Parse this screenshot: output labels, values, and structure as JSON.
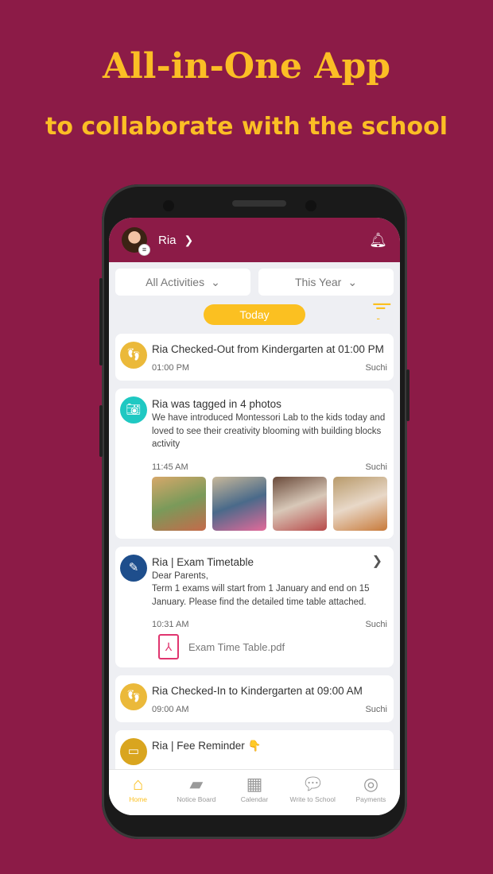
{
  "promo": {
    "title": "All-in-One App",
    "subtitle": "to collaborate with the school"
  },
  "header": {
    "child_name": "Ria"
  },
  "filters": {
    "activity": "All Activities",
    "period": "This Year"
  },
  "today_label": "Today",
  "colors": {
    "brand": "#8C1B47",
    "accent": "#FBC021"
  },
  "feed": [
    {
      "icon": "footprints-icon",
      "title": "Ria Checked-Out from Kindergarten at 01:00 PM",
      "time": "01:00 PM",
      "author": "Suchi"
    },
    {
      "icon": "camera-icon",
      "title": "Ria was tagged in 4 photos",
      "body": "We have introduced Montessori Lab to the kids today and loved to see their creativity blooming with building blocks activity",
      "time": "11:45 AM",
      "author": "Suchi"
    },
    {
      "icon": "pencil-icon",
      "title": "Ria | Exam Timetable",
      "body": "Dear Parents,\nTerm 1 exams will start from 1 January and end on 15 January. Please find the detailed time table attached.",
      "time": "10:31 AM",
      "author": "Suchi",
      "attachment": "Exam Time Table.pdf"
    },
    {
      "icon": "footprints-icon",
      "title": "Ria Checked-In to Kindergarten at 09:00 AM",
      "time": "09:00 AM",
      "author": "Suchi"
    },
    {
      "icon": "fee-icon",
      "title": "Ria | Fee Reminder 👇"
    }
  ],
  "nav": [
    {
      "label": "Home",
      "icon": "home-icon"
    },
    {
      "label": "Notice Board",
      "icon": "notice-board-icon"
    },
    {
      "label": "Calendar",
      "icon": "calendar-icon"
    },
    {
      "label": "Write to School",
      "icon": "chat-icon"
    },
    {
      "label": "Payments",
      "icon": "coins-icon"
    }
  ]
}
